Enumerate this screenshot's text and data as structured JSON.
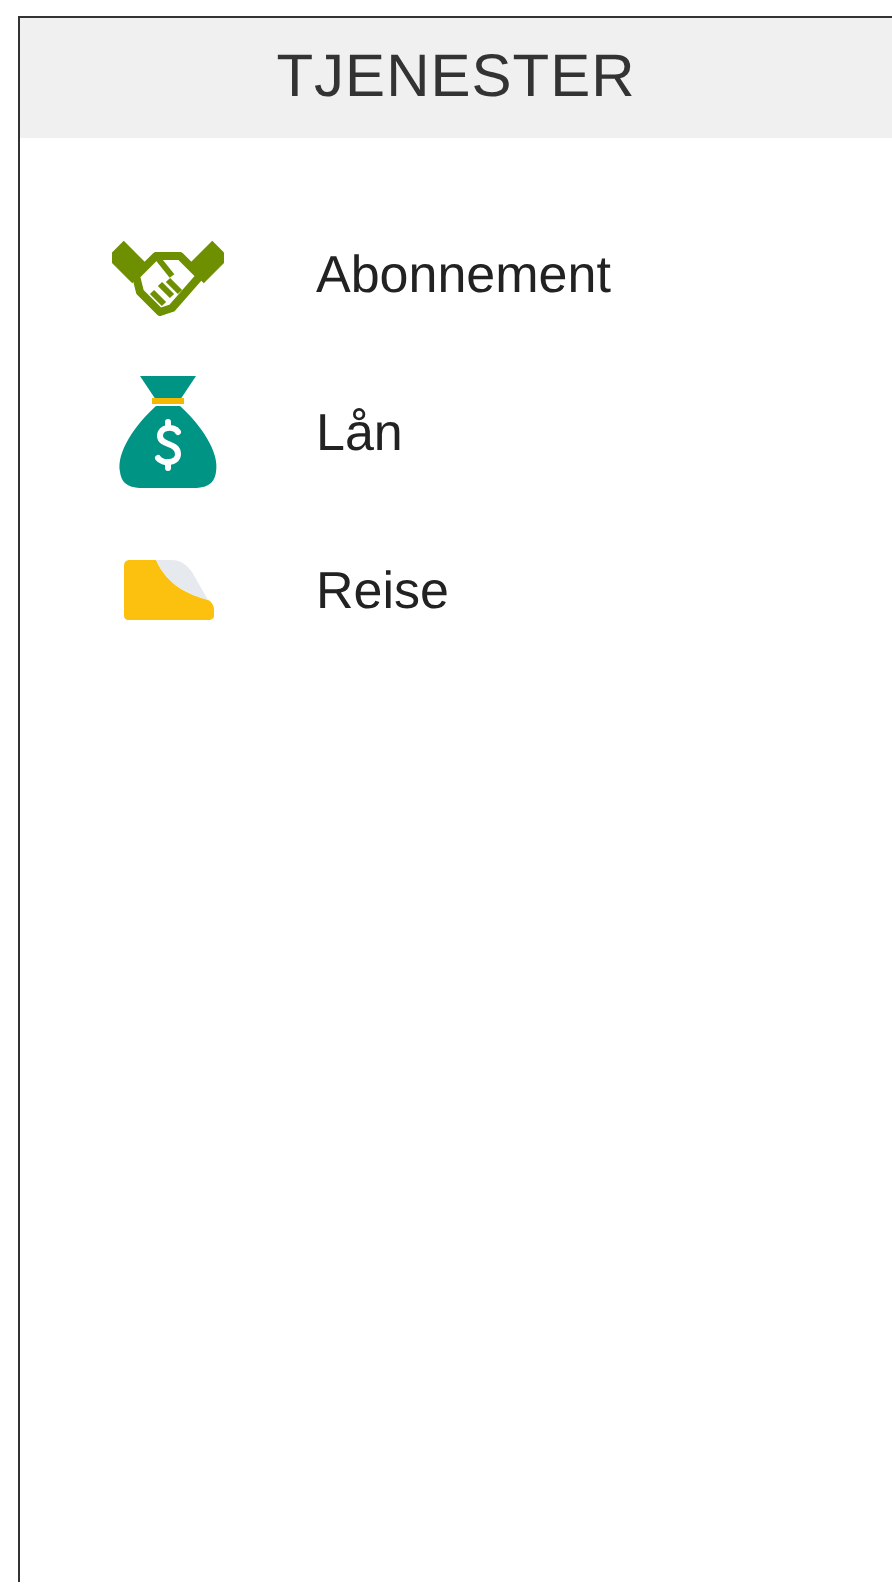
{
  "header": {
    "title": "TJENESTER"
  },
  "services": [
    {
      "label": "Abonnement"
    },
    {
      "label": "Lån"
    },
    {
      "label": "Reise"
    }
  ]
}
